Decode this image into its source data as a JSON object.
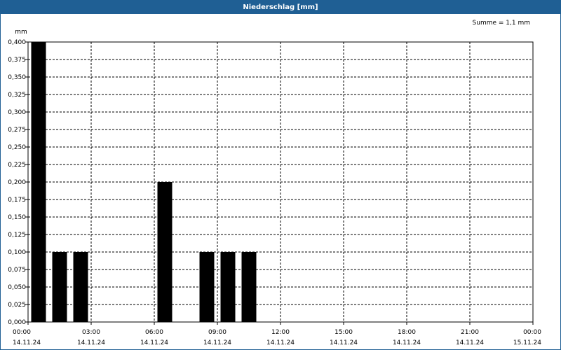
{
  "window": {
    "title": "Niederschlag [mm]"
  },
  "chart_data": {
    "type": "bar",
    "title": "Niederschlag [mm]",
    "ylabel": "mm",
    "xlabel": "",
    "annotation": "Summe = 1,1 mm",
    "ylim": [
      0,
      0.4
    ],
    "y_ticks": [
      "0,000",
      "0,025",
      "0,050",
      "0,075",
      "0,100",
      "0,125",
      "0,150",
      "0,175",
      "0,200",
      "0,225",
      "0,250",
      "0,275",
      "0,300",
      "0,325",
      "0,350",
      "0,375",
      "0,400"
    ],
    "x_ticks": [
      {
        "time": "00:00",
        "date": "14.11.24"
      },
      {
        "time": "03:00",
        "date": "14.11.24"
      },
      {
        "time": "06:00",
        "date": "14.11.24"
      },
      {
        "time": "09:00",
        "date": "14.11.24"
      },
      {
        "time": "12:00",
        "date": "14.11.24"
      },
      {
        "time": "15:00",
        "date": "14.11.24"
      },
      {
        "time": "18:00",
        "date": "14.11.24"
      },
      {
        "time": "21:00",
        "date": "14.11.24"
      },
      {
        "time": "00:00",
        "date": "15.11.24"
      }
    ],
    "x_range": [
      "14.11.24 00:00",
      "15.11.24 00:00"
    ],
    "bar_color": "#000000",
    "grid": true,
    "bars": [
      {
        "time": "14.11.24 00:00",
        "value": 0.4
      },
      {
        "time": "14.11.24 01:00",
        "value": 0.1
      },
      {
        "time": "14.11.24 02:00",
        "value": 0.1
      },
      {
        "time": "14.11.24 06:00",
        "value": 0.2
      },
      {
        "time": "14.11.24 08:00",
        "value": 0.1
      },
      {
        "time": "14.11.24 09:00",
        "value": 0.1
      },
      {
        "time": "14.11.24 10:00",
        "value": 0.1
      }
    ]
  }
}
